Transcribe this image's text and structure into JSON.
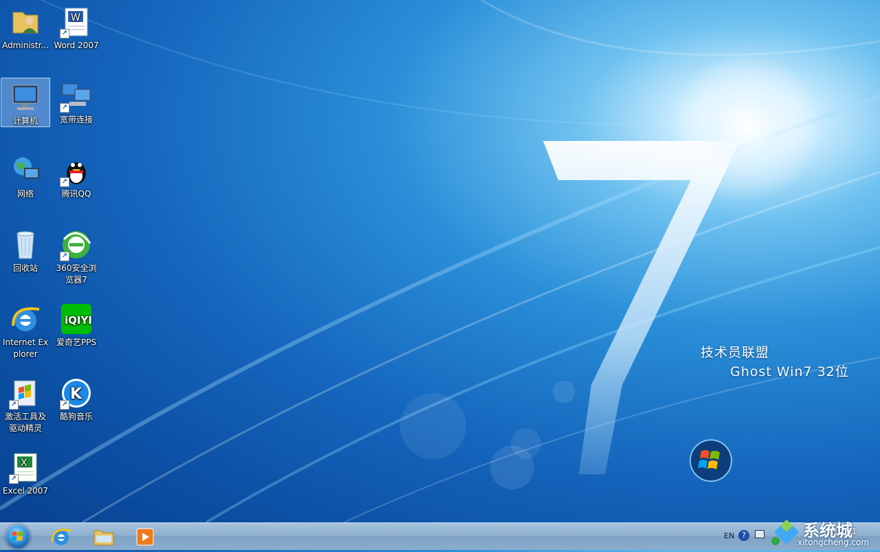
{
  "desktop": {
    "icons": [
      {
        "label": "Administr...",
        "icon": "user-folder-icon"
      },
      {
        "label": "Word 2007",
        "icon": "word-icon"
      },
      {
        "label": "计算机",
        "icon": "computer-icon"
      },
      {
        "label": "宽带连接",
        "icon": "broadband-icon"
      },
      {
        "label": "网络",
        "icon": "network-icon"
      },
      {
        "label": "腾讯QQ",
        "icon": "qq-icon"
      },
      {
        "label": "回收站",
        "icon": "recycle-bin-icon"
      },
      {
        "label": "360安全浏览器7",
        "icon": "360-browser-icon"
      },
      {
        "label": "Internet Explorer",
        "icon": "internet-explorer-icon"
      },
      {
        "label": "爱奇艺PPS",
        "icon": "iqiyi-icon"
      },
      {
        "label": "激活工具及驱动精灵",
        "icon": "activation-tool-icon"
      },
      {
        "label": "酷狗音乐",
        "icon": "kugou-icon"
      },
      {
        "label": "Excel 2007",
        "icon": "excel-icon"
      }
    ]
  },
  "wallpaper": {
    "brand_line1": "技术员联盟",
    "brand_line2": "Ghost Win7 32位",
    "numeral": "7"
  },
  "taskbar": {
    "start_icon": "windows-start-orb-icon",
    "pinned": [
      {
        "name": "internet-explorer",
        "icon": "internet-explorer-icon"
      },
      {
        "name": "windows-explorer",
        "icon": "folder-icon"
      },
      {
        "name": "media-player",
        "icon": "media-player-icon"
      }
    ],
    "tray": {
      "language": "EN",
      "clock": "14:41"
    }
  },
  "watermark": {
    "text": "系统城",
    "url": "xitongcheng.com"
  }
}
